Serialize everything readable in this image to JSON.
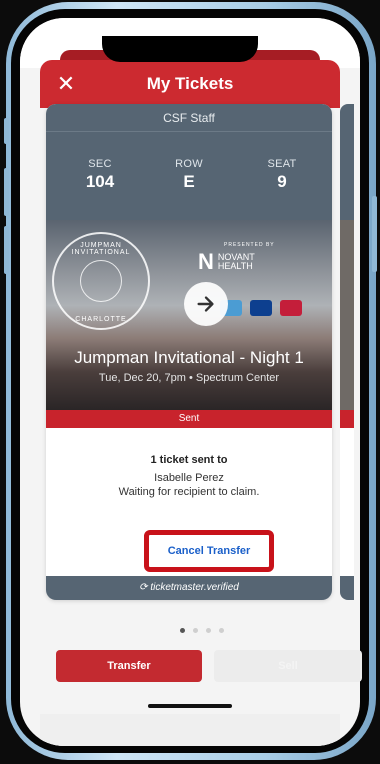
{
  "header": {
    "title": "My Tickets",
    "close_icon": "close-icon"
  },
  "ticket": {
    "group": "CSF Staff",
    "sec_label": "SEC",
    "sec_value": "104",
    "row_label": "ROW",
    "row_value": "E",
    "seat_label": "SEAT",
    "seat_value": "9",
    "image": {
      "badge_top": "JUMPMAN INVITATIONAL",
      "badge_bottom": "CHARLOTTE",
      "presented_by": "PRESENTED BY",
      "sponsor_mark": "N",
      "sponsor_line1": "NOVANT",
      "sponsor_line2": "HEALTH"
    },
    "event_name": "Jumpman Invitational - Night 1",
    "event_meta": "Tue, Dec 20, 7pm • Spectrum Center",
    "status": "Sent",
    "info_title": "1 ticket sent to",
    "recipient": "Isabelle Perez",
    "waiting": "Waiting for recipient to claim.",
    "cancel_label": "Cancel Transfer",
    "footer": "ticketmaster.verified"
  },
  "pager": {
    "count": 4,
    "active": 0
  },
  "actions": {
    "transfer_label": "Transfer",
    "sell_label": "Sell"
  },
  "colors": {
    "brand_red": "#cc2a30",
    "card_slate": "#566573",
    "link_blue": "#1a5fc9",
    "highlight": "#c8121a"
  }
}
